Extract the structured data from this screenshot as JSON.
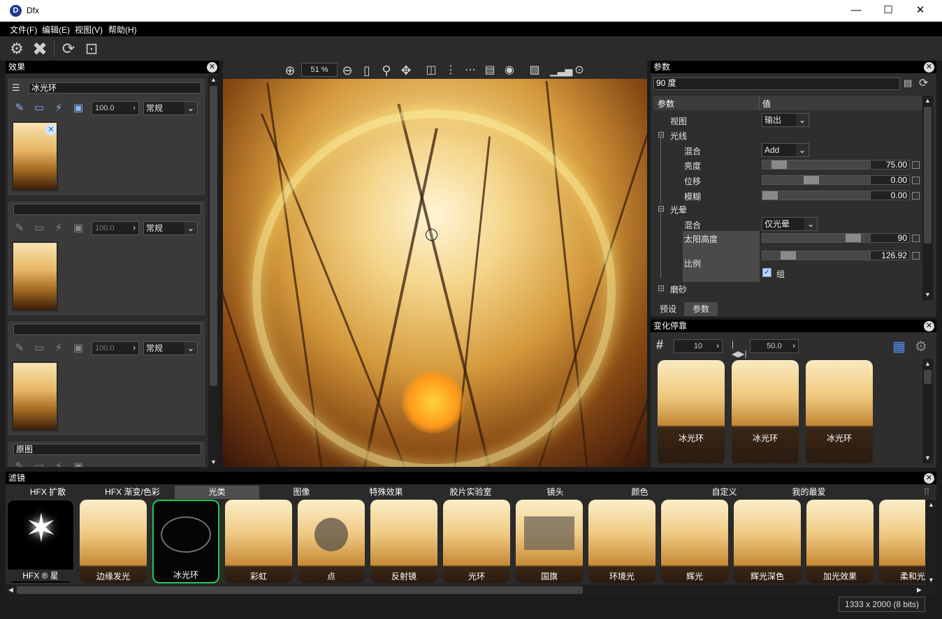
{
  "window": {
    "title": "Dfx",
    "logo_text": "D",
    "minimize": "—",
    "maximize": "☐",
    "close": "✕"
  },
  "menu": [
    "文件(F)",
    "编辑(E)",
    "视图(V)",
    "帮助(H)"
  ],
  "toolbar": {
    "icons": [
      "gear-icon",
      "close-x-icon",
      "refresh-icon",
      "fit-icon"
    ]
  },
  "effects_panel": {
    "title": "效果",
    "layers": [
      {
        "name": "冰光环",
        "opacity": "100.0",
        "blend": "常规"
      },
      {
        "name": "",
        "opacity": "100.0",
        "blend": "常规"
      },
      {
        "name": "",
        "opacity": "100.0",
        "blend": "常规"
      },
      {
        "name": "原图",
        "opacity": "",
        "blend": ""
      }
    ]
  },
  "canvas": {
    "zoom": "51 %"
  },
  "params_panel": {
    "title": "参数",
    "value_field": "90 度",
    "col_param": "参数",
    "col_value": "值",
    "rows": [
      {
        "label": "视图",
        "type": "combo",
        "value": "输出"
      },
      {
        "label": "光线",
        "type": "group"
      },
      {
        "label": "混合",
        "type": "combo",
        "value": "Add"
      },
      {
        "label": "亮度",
        "type": "slider",
        "value": "75.00",
        "knob": 0.1
      },
      {
        "label": "位移",
        "type": "slider",
        "value": "0.00",
        "knob": 0.45
      },
      {
        "label": "模糊",
        "type": "slider",
        "value": "0.00",
        "knob": 0.0
      },
      {
        "label": "光晕",
        "type": "group"
      },
      {
        "label": "混合",
        "type": "combo",
        "value": "仅光晕"
      },
      {
        "label": "太阳高度",
        "type": "slider",
        "value": "90",
        "knob": 0.9
      },
      {
        "label": "比例",
        "type": "slider",
        "value": "126.92",
        "knob": 0.2
      },
      {
        "label": "组",
        "type": "checkbox",
        "value": "组"
      },
      {
        "label": "磨砂",
        "type": "group"
      }
    ],
    "tabs": [
      "预设",
      "参数"
    ]
  },
  "transitions_panel": {
    "title": "变化停靠",
    "count": "10",
    "value": "50.0",
    "thumbs": [
      "冰光环",
      "冰光环",
      "冰光环"
    ]
  },
  "filters_panel": {
    "title": "滤镜",
    "tabs": [
      "HFX 扩散",
      "HFX 渐变/色彩",
      "光类",
      "图像",
      "特殊效果",
      "胶片实验室",
      "镜头",
      "颜色",
      "自定义",
      "我的最爱"
    ],
    "active_tab": "光类",
    "tiles": [
      "HFX ® 星",
      "边缘发光",
      "冰光环",
      "彩虹",
      "点",
      "反射镜",
      "光环",
      "国旗",
      "环境光",
      "辉光",
      "辉光深色",
      "加光效果",
      "柔和光"
    ],
    "selected_tile": "冰光环"
  },
  "status": {
    "image_info": "1333 x 2000 (8 bits)"
  },
  "colors": {
    "accent_green": "#22c55e",
    "panel_bg": "#2e2e2e",
    "header_bg": "#000000"
  }
}
